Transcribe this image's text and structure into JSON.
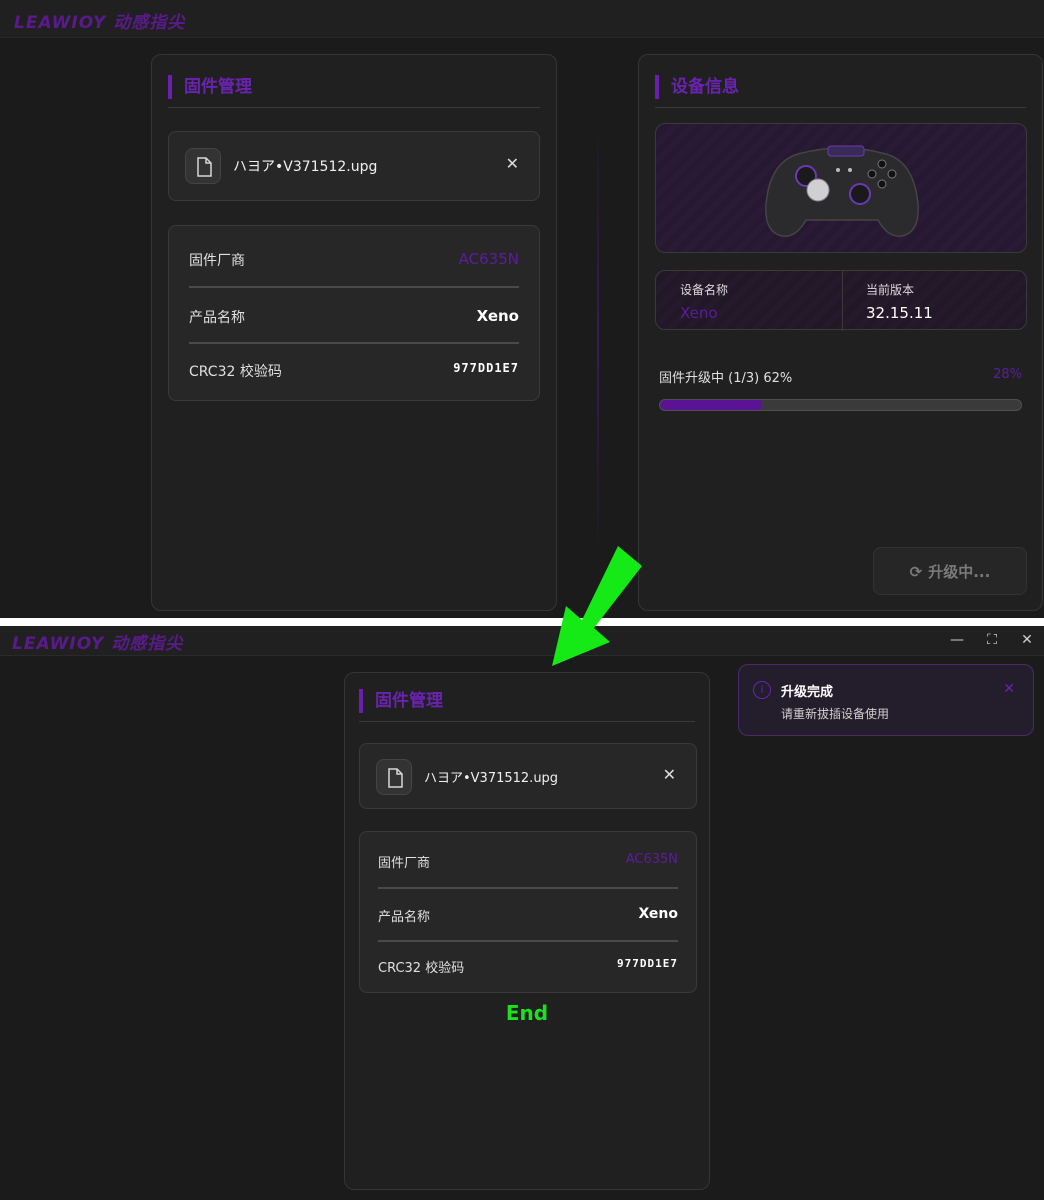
{
  "app": {
    "logo": "LEAWIOY 动感指尖",
    "window_controls": [
      "—",
      "⛶",
      "✕"
    ]
  },
  "before": {
    "firmware_panel": {
      "title": "固件管理",
      "file": {
        "name": "ハヨア•V371512.upg",
        "icon": "file-icon"
      },
      "info": [
        {
          "label": "固件厂商",
          "value": "AC635N"
        },
        {
          "label": "产品名称",
          "value": "Xeno"
        },
        {
          "label": "CRC32 校验码",
          "value": "977DD1E7"
        }
      ]
    },
    "device_panel": {
      "title": "设备信息",
      "device_name_label": "设备名称",
      "device_name": "Xeno",
      "version_label": "当前版本",
      "version": "32.15.11",
      "progress_label": "固件升级中 (1/3) 62%",
      "progress_percent": "28%",
      "progress_value": 0.28,
      "upgrade_button": "升级中..."
    }
  },
  "after": {
    "firmware_panel": {
      "title": "固件管理",
      "file": {
        "name": "ハヨア•V371512.upg",
        "icon": "file-icon"
      },
      "info": [
        {
          "label": "固件厂商",
          "value": "AC635N"
        },
        {
          "label": "产品名称",
          "value": "Xeno"
        },
        {
          "label": "CRC32 校验码",
          "value": "977DD1E7"
        }
      ]
    },
    "toast": {
      "title": "升级完成",
      "message": "请重新拔插设备使用",
      "icon": "info-icon"
    },
    "end_label": "End"
  },
  "colors": {
    "accent": "#6a23b0",
    "annotation": "#1fe01f"
  }
}
